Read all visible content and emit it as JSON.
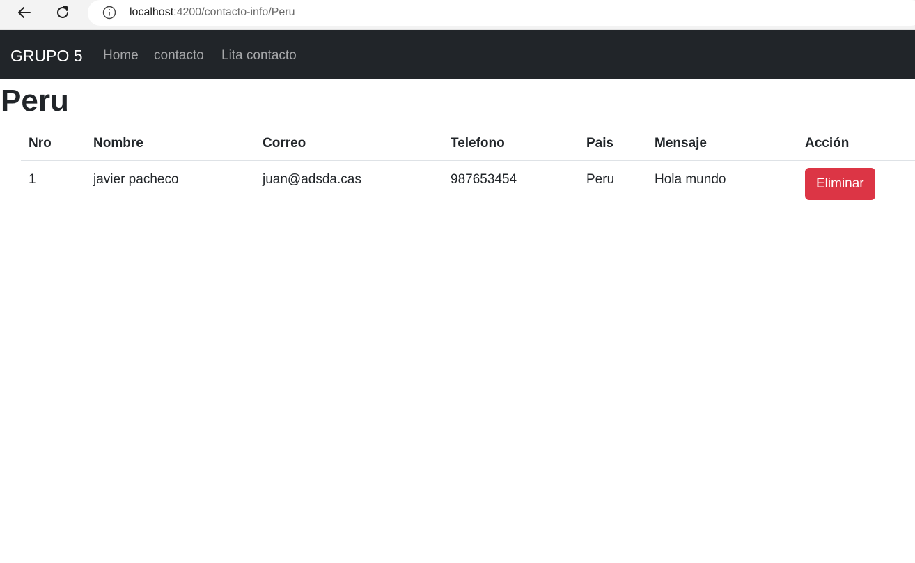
{
  "browser": {
    "url_host": "localhost",
    "url_path": ":4200/contacto-info/Peru"
  },
  "navbar": {
    "brand": "GRUPO 5",
    "links": [
      "Home",
      "contacto",
      "Lita contacto"
    ]
  },
  "page": {
    "title": "Peru"
  },
  "table": {
    "headers": [
      "Nro",
      "Nombre",
      "Correo",
      "Telefono",
      "Pais",
      "Mensaje",
      "Acción"
    ],
    "rows": [
      {
        "nro": "1",
        "nombre": "javier pacheco",
        "correo": "juan@adsda.cas",
        "telefono": "987653454",
        "pais": "Peru",
        "mensaje": "Hola mundo",
        "accion_label": "Eliminar"
      }
    ]
  },
  "colors": {
    "navbar_bg": "#212529",
    "danger": "#dc3545"
  },
  "icons": [
    "back-arrow-icon",
    "reload-icon",
    "info-icon"
  ]
}
